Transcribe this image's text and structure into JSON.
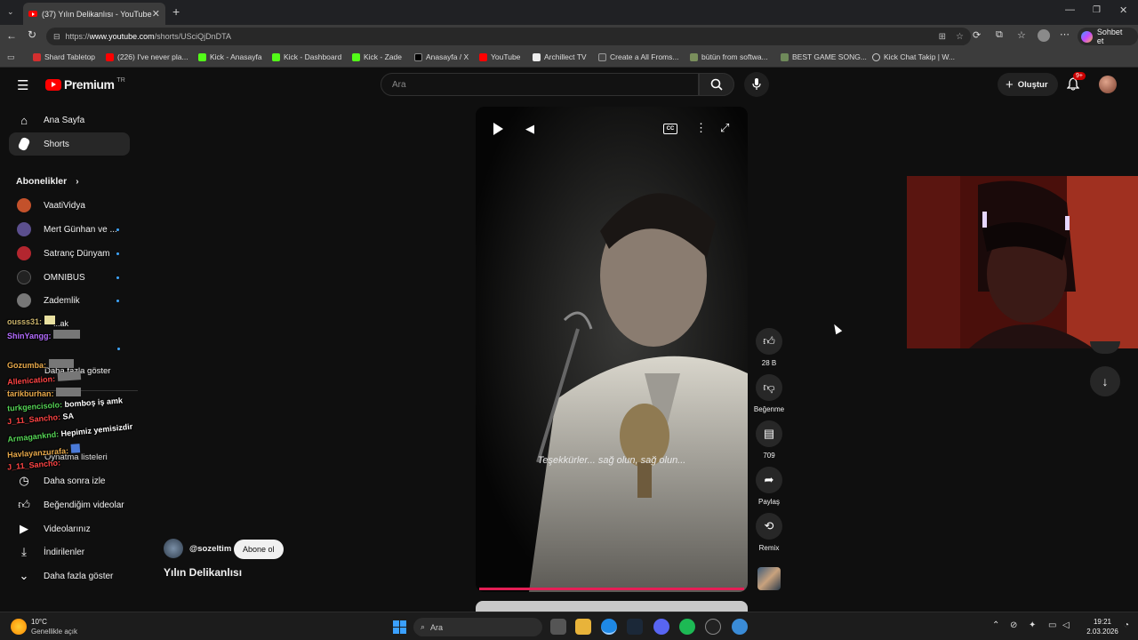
{
  "browser": {
    "tab_title": "(37) Yılın Delikanlısı - YouTube",
    "url_prefix": "https://",
    "url_host": "www.youtube.com",
    "url_path": "/shorts/USciQjDnDTA",
    "chat_button": "Sohbet et",
    "bookmarks": [
      "Shard Tabletop",
      "(226) I've never pla...",
      "Kick - Anasayfa",
      "Kick - Dashboard",
      "Kick - Zade",
      "Anasayfa / X",
      "YouTube",
      "Archillect TV",
      "Create a All Froms...",
      "bütün from softwa...",
      "BEST GAME SONG...",
      "Kick Chat Takip | W..."
    ]
  },
  "youtube": {
    "logo": "Premium",
    "logo_region": "TR",
    "search_placeholder": "Ara",
    "create_label": "Oluştur",
    "notif_count": "9+",
    "sidebar": {
      "home": "Ana Sayfa",
      "shorts": "Shorts",
      "subs_header": "Abonelikler",
      "subs": [
        "VaatiVidya",
        "Mert Günhan ve ...",
        "Satranç Dünyam",
        "OMNIBUS",
        "Zademlik"
      ],
      "bottom": [
        "Daha sonra izle",
        "Beğendiğim videolar",
        "Videolarınız",
        "İndirilenler",
        "Daha fazla göster"
      ]
    },
    "short": {
      "channel": "@sozeltim",
      "subscribe": "Abone ol",
      "title": "Yılın Delikanlısı",
      "subtitle": "Teşekkürler... sağ olun, sağ olun...",
      "likes": "28 B",
      "dislike": "Beğenme",
      "comments": "709",
      "share": "Paylaş",
      "remix": "Remix"
    }
  },
  "chat": [
    {
      "user": "ousss31:",
      "msg": "",
      "color": "#c9b26b"
    },
    {
      "user": "ShinYangg:",
      "msg": "",
      "color": "#b46cff"
    },
    {
      "user": "Gozumba:",
      "msg": "",
      "color": "#e8a94a"
    },
    {
      "user": "Allenication:",
      "msg": "",
      "color": "#ff4444"
    },
    {
      "user": "tarikburhan:",
      "msg": "",
      "color": "#e8a94a"
    },
    {
      "user": "turkgencisolo:",
      "msg": "bomboş iş amk",
      "color": "#55d455"
    },
    {
      "user": "J_11_Sancho:",
      "msg": "SA",
      "color": "#ff4444"
    },
    {
      "user": "Armaganknd:",
      "msg": "Hepimiz yemisizdir",
      "color": "#55d455"
    },
    {
      "user": "Havlayanzurafa:",
      "msg": "",
      "color": "#e8a94a"
    },
    {
      "user": "J_11_Sancho:",
      "msg": "",
      "color": "#ff4444"
    }
  ],
  "partial_sidebar": {
    "item1": "...ak",
    "more": "Daha fazla göster",
    "played": "Oynatma listeleri"
  },
  "taskbar": {
    "temp": "10°C",
    "weather": "Genellikle açık",
    "search": "Ara",
    "time": "19:21",
    "date": "2.03.2026"
  }
}
